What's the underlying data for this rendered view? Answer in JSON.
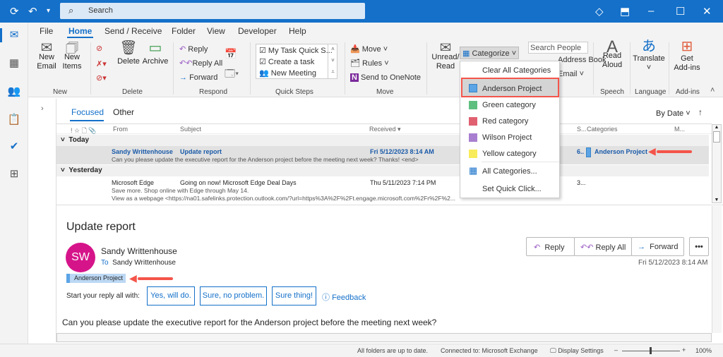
{
  "title_bar": {
    "search_placeholder": "Search"
  },
  "menu": {
    "tabs": [
      "File",
      "Home",
      "Send / Receive",
      "Folder",
      "View",
      "Developer",
      "Help"
    ],
    "active": "Home"
  },
  "ribbon": {
    "new": {
      "new_email": [
        "New",
        "Email"
      ],
      "new_items": [
        "New",
        "Items"
      ],
      "group": "New"
    },
    "delete": {
      "delete": "Delete",
      "archive": "Archive",
      "group": "Delete"
    },
    "respond": {
      "reply": "Reply",
      "reply_all": "Reply All",
      "forward": "Forward",
      "group": "Respond"
    },
    "quick_steps": {
      "items": [
        "My Task Quick S...",
        "Create a task",
        "New Meeting"
      ],
      "group": "Quick Steps"
    },
    "move": {
      "move": "Move",
      "rules": "Rules",
      "onenote": "Send to OneNote",
      "group": "Move"
    },
    "tags": {
      "unread": [
        "Unread/",
        "Read"
      ],
      "categorize": "Categorize"
    },
    "find": {
      "search_people": "Search People",
      "address_book": "Address Book",
      "email": "Email"
    },
    "speech": {
      "read_aloud": [
        "Read",
        "Aloud"
      ],
      "group": "Speech"
    },
    "language": {
      "translate": "Translate",
      "group": "Language"
    },
    "addins": {
      "get": [
        "Get",
        "Add-ins"
      ],
      "group": "Add-ins"
    }
  },
  "list": {
    "tabs": [
      "Focused",
      "Other"
    ],
    "sort": "By Date",
    "columns": [
      "From",
      "Subject",
      "Received",
      "S...",
      "Categories",
      "M..."
    ],
    "groups": [
      "Today",
      "Yesterday"
    ],
    "messages": [
      {
        "from": "Sandy Writtenhouse",
        "subject": "Update report",
        "received": "Fri 5/12/2023 8:14 AM",
        "size": "6..",
        "category": "Anderson Project",
        "preview": "Can you please update the executive report for the Anderson project before the meeting next week?   Thanks!  <end>"
      },
      {
        "from": "Microsoft Edge",
        "subject": "Going on now! Microsoft Edge Deal Days",
        "received": "Thu 5/11/2023 7:14 PM",
        "size": "3...",
        "preview": "Save more. Shop online with Edge through May 14.",
        "preview2": "View as a webpage <https://na01.safelinks.protection.outlook.com/?url=https%3A%2F%2Ft.engage.microsoft.com%2Fr%2F%2..."
      }
    ]
  },
  "categorize_menu": {
    "items": [
      {
        "label": "Clear All Categories"
      },
      {
        "label": "Anderson Project",
        "color": "#5ba4e6"
      },
      {
        "label": "Green category",
        "color": "#5fbf7f"
      },
      {
        "label": "Red category",
        "color": "#e06070"
      },
      {
        "label": "Wilson Project",
        "color": "#a87fd0"
      },
      {
        "label": "Yellow category",
        "color": "#f8ec5a"
      },
      {
        "label": "All Categories..."
      },
      {
        "label": "Set Quick Click..."
      }
    ]
  },
  "reading": {
    "subject": "Update report",
    "avatar": "SW",
    "sender": "Sandy Writtenhouse",
    "to_label": "To",
    "to": "Sandy Writtenhouse",
    "date": "Fri 5/12/2023 8:14 AM",
    "category": "Anderson Project",
    "reply": "Reply",
    "reply_all": "Reply All",
    "forward": "Forward",
    "more": "•••",
    "suggest_label": "Start your reply all with:",
    "suggestions": [
      "Yes, will do.",
      "Sure, no problem.",
      "Sure thing!"
    ],
    "feedback": "Feedback",
    "body": "Can you please update the executive report for the Anderson project before the meeting next week?"
  },
  "status": {
    "sync": "All folders are up to date.",
    "connection": "Connected to: Microsoft Exchange",
    "display": "Display Settings",
    "zoom": "100%"
  }
}
